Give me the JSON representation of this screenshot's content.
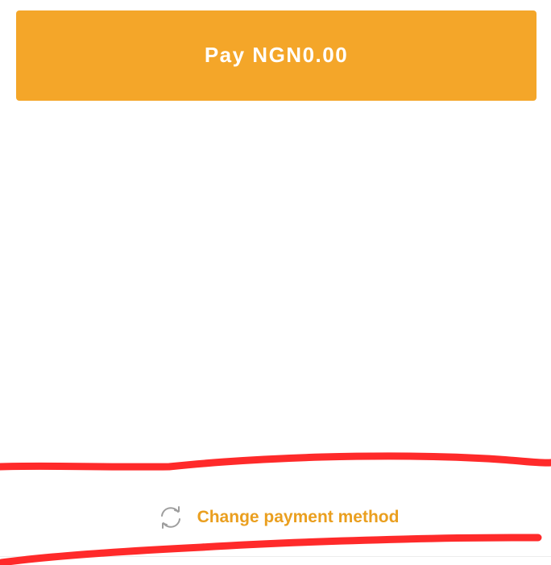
{
  "pay_button": {
    "label": "Pay NGN0.00",
    "color": "#f4a629"
  },
  "change_payment": {
    "label": "Change payment method",
    "icon": "refresh-icon",
    "color": "#ea9f1f"
  },
  "annotation": {
    "color": "#ff2a2a"
  }
}
